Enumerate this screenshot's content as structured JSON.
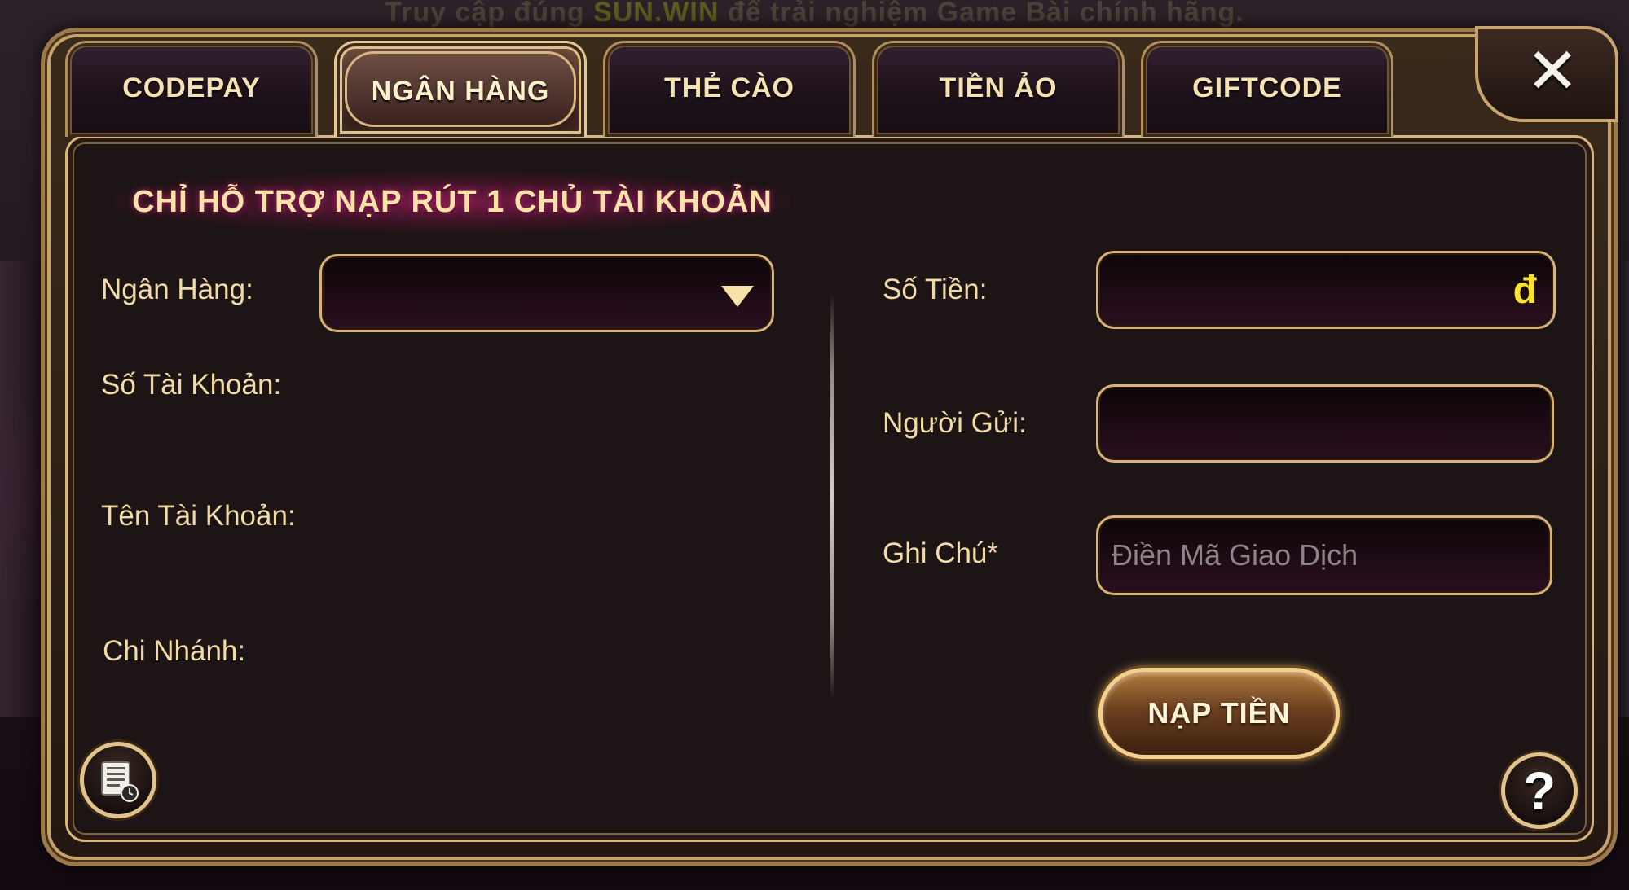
{
  "banner": {
    "text_before": "Truy cập đúng ",
    "highlight": "SUN.WIN",
    "text_after": " để trải nghiệm Game Bài chính hãng."
  },
  "tabs": [
    {
      "label": "CODEPAY",
      "active": false
    },
    {
      "label": "NGÂN HÀNG",
      "active": true
    },
    {
      "label": "THẺ CÀO",
      "active": false
    },
    {
      "label": "TIỀN ẢO",
      "active": false
    },
    {
      "label": "GIFTCODE",
      "active": false
    }
  ],
  "notice": "CHỈ HỖ TRỢ NẠP RÚT 1 CHỦ TÀI KHOẢN",
  "left_form": {
    "bank_label": "Ngân Hàng:",
    "bank_value": "",
    "account_number_label": "Số Tài Khoản:",
    "account_name_label": "Tên Tài Khoản:",
    "branch_label": "Chi Nhánh:"
  },
  "right_form": {
    "amount_label": "Số Tiền:",
    "amount_value": "",
    "currency_symbol": "đ",
    "sender_label": "Người Gửi:",
    "sender_value": "",
    "note_label": "Ghi Chú*",
    "note_placeholder": "Điền Mã Giao Dịch"
  },
  "submit_label": "NẠP TIỀN",
  "help_glyph": "?",
  "close_glyph": "✕",
  "icons": {
    "history": "history-document-icon",
    "help": "help-question-icon",
    "close": "close-icon",
    "dropdown": "chevron-down-icon"
  },
  "colors": {
    "gold_text": "#f1dca8",
    "frame_gold": "#d9b27a",
    "currency_yellow": "#f7e22c",
    "panel_bg": "#1d1415"
  }
}
